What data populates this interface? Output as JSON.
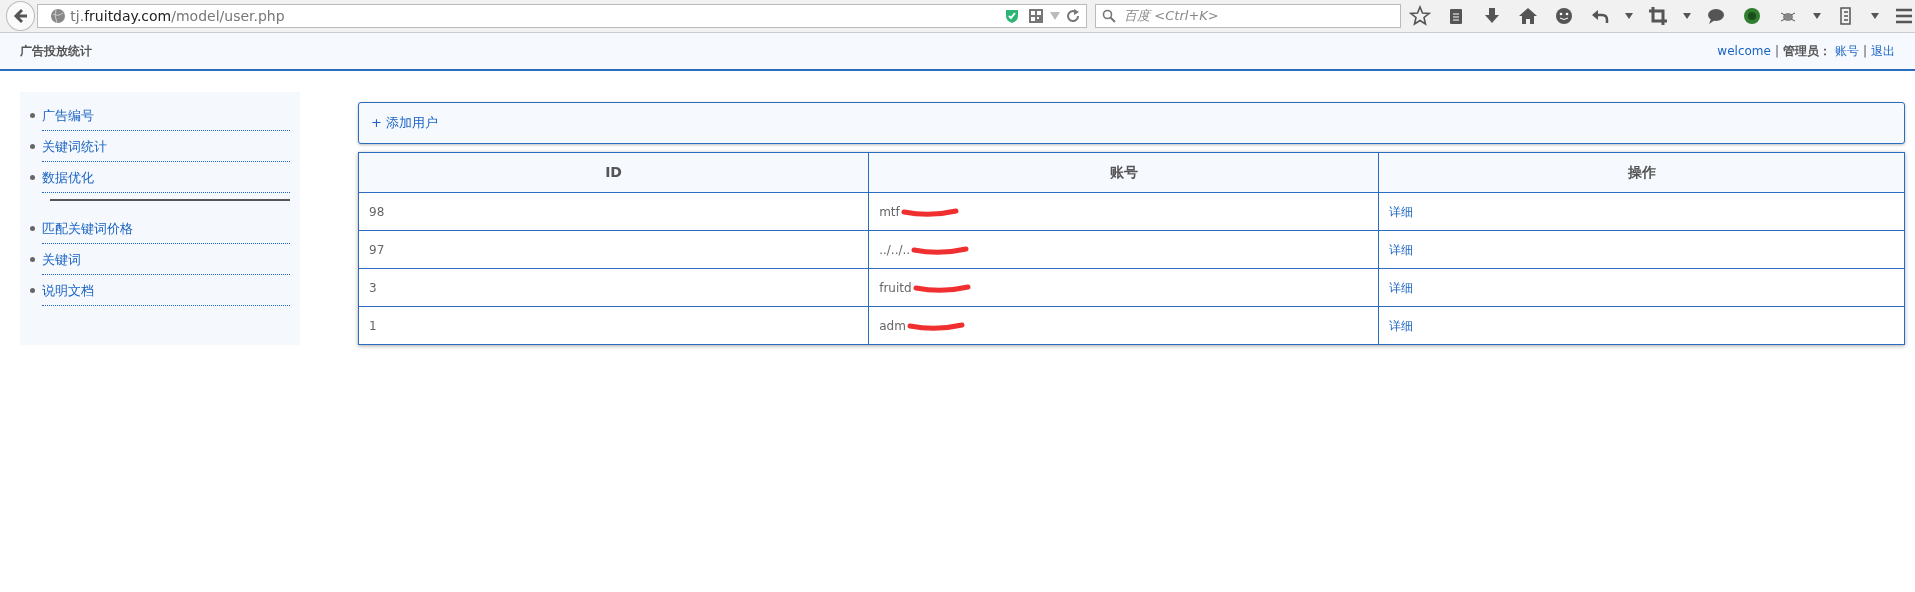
{
  "browser": {
    "url": {
      "subdomain": "tj.",
      "domain": "fruitday.com",
      "path": "/model/user.php"
    },
    "search": {
      "placeholder": "百度 <Ctrl+K>"
    }
  },
  "header": {
    "title": "广告投放统计",
    "welcome": "welcome",
    "separator": "|",
    "role": "管理员：",
    "links": [
      "账号",
      "退出"
    ]
  },
  "sidebar": {
    "groups": [
      [
        {
          "label": "广告编号"
        },
        {
          "label": "关键词统计"
        },
        {
          "label": "数据优化"
        }
      ],
      [
        {
          "label": "匹配关键词价格"
        },
        {
          "label": "关键词"
        },
        {
          "label": "说明文档"
        }
      ]
    ]
  },
  "add_user": {
    "icon": "+",
    "label": "添加用户"
  },
  "table": {
    "columns": [
      "ID",
      "账号",
      "操作"
    ],
    "rows": [
      {
        "id": "98",
        "account": "mtf",
        "redacted": true,
        "action": "详细"
      },
      {
        "id": "97",
        "account": "../../..",
        "redacted": true,
        "action": "详细"
      },
      {
        "id": "3",
        "account": "fruitd",
        "redacted": true,
        "action": "详细"
      },
      {
        "id": "1",
        "account": "adm",
        "redacted": true,
        "action": "详细"
      }
    ]
  }
}
